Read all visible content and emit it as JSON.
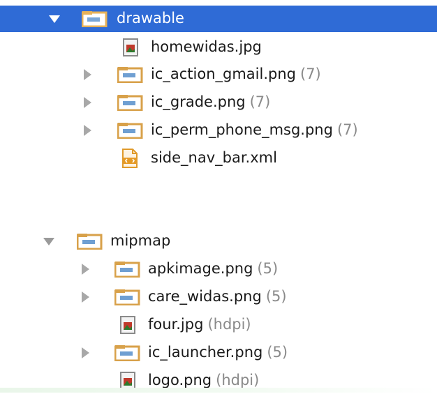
{
  "tree": {
    "drawable": {
      "label": "drawable",
      "children": [
        {
          "name": "homewidas.jpg",
          "count": ""
        },
        {
          "name": "ic_action_gmail.png",
          "count": "(7)"
        },
        {
          "name": "ic_grade.png",
          "count": "(7)"
        },
        {
          "name": "ic_perm_phone_msg.png",
          "count": "(7)"
        },
        {
          "name": "side_nav_bar.xml",
          "count": ""
        }
      ]
    },
    "mipmap": {
      "label": "mipmap",
      "children": [
        {
          "name": "apkimage.png",
          "count": "(5)"
        },
        {
          "name": "care_widas.png",
          "count": "(5)"
        },
        {
          "name": "four.jpg",
          "count": "(hdpi)"
        },
        {
          "name": "ic_launcher.png",
          "count": "(5)"
        },
        {
          "name": "logo.png",
          "count": "(hdpi)"
        }
      ]
    }
  },
  "colors": {
    "selection": "#2f6bd6",
    "folder": "#d8a14a",
    "count_text": "#8a8a8a"
  },
  "icons": {
    "folder": "folder-icon",
    "image_file": "image-file-icon",
    "xml_file": "xml-file-icon",
    "expand": "chevron-down-icon",
    "collapse": "chevron-right-icon"
  }
}
